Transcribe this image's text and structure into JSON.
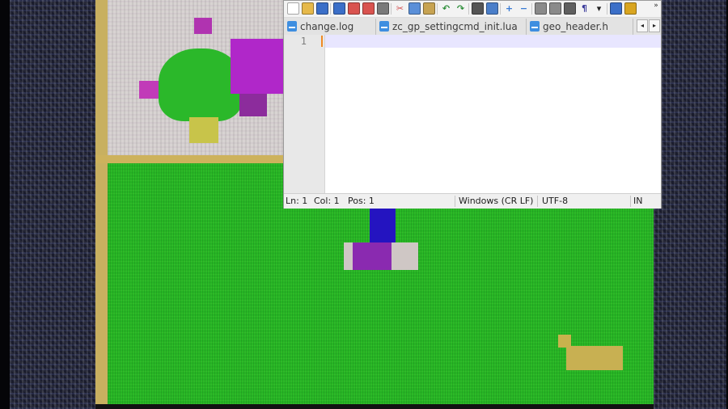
{
  "toolbar": {
    "buttons": [
      {
        "name": "new-file-icon",
        "glyph": "",
        "color": "#ffffff"
      },
      {
        "name": "open-file-icon",
        "glyph": "",
        "color": "#e6b94a"
      },
      {
        "name": "save-icon",
        "glyph": "",
        "color": "#3b6fc8"
      },
      {
        "name": "save-all-icon",
        "glyph": "",
        "color": "#3b6fc8"
      },
      {
        "name": "close-icon",
        "glyph": "",
        "color": "#d9534f"
      },
      {
        "name": "close-all-icon",
        "glyph": "",
        "color": "#d9534f"
      },
      {
        "name": "print-icon",
        "glyph": "",
        "color": "#7a7a7a"
      },
      {
        "name": "cut-icon",
        "glyph": "✂",
        "color": "#d24b4b"
      },
      {
        "name": "copy-icon",
        "glyph": "",
        "color": "#5a8fd8"
      },
      {
        "name": "paste-icon",
        "glyph": "",
        "color": "#c7a352"
      },
      {
        "name": "undo-icon",
        "glyph": "↶",
        "color": "#2f8f3b"
      },
      {
        "name": "redo-icon",
        "glyph": "↷",
        "color": "#2f8f3b"
      },
      {
        "name": "find-icon",
        "glyph": "",
        "color": "#555555"
      },
      {
        "name": "replace-icon",
        "glyph": "",
        "color": "#4a7ec9"
      },
      {
        "name": "zoom-in-icon",
        "glyph": "+",
        "color": "#3a7bd5"
      },
      {
        "name": "zoom-out-icon",
        "glyph": "−",
        "color": "#3a7bd5"
      },
      {
        "name": "sync-vertical-icon",
        "glyph": "",
        "color": "#8a8a8a"
      },
      {
        "name": "sync-horizontal-icon",
        "glyph": "",
        "color": "#8a8a8a"
      },
      {
        "name": "word-wrap-icon",
        "glyph": "",
        "color": "#5f5f5f"
      },
      {
        "name": "show-all-characters-icon",
        "glyph": "¶",
        "color": "#3a3a9a"
      },
      {
        "name": "dropdown-arrow-icon",
        "glyph": "▾",
        "color": "#222222"
      },
      {
        "name": "indent-guide-icon",
        "glyph": "",
        "color": "#3b6fc8"
      },
      {
        "name": "user-language-icon",
        "glyph": "",
        "color": "#d9a520"
      }
    ],
    "overflow_glyph": "»"
  },
  "tabs": [
    {
      "label": "change.log"
    },
    {
      "label": "zc_gp_settingcmd_init.lua"
    },
    {
      "label": "geo_header.h"
    }
  ],
  "tab_scroll": {
    "left": "◂",
    "right": "▸"
  },
  "editor": {
    "line_number": "1",
    "content": ""
  },
  "status": {
    "ln": "Ln: 1",
    "col": "Col: 1",
    "pos": "Pos: 1",
    "eol": "Windows (CR LF)",
    "encoding": "UTF-8",
    "mode": "IN"
  },
  "colors": {
    "accent": "#3e8ee0",
    "caret": "#f08a24",
    "current_line": "#e8e6ff",
    "grass": "#27b525"
  }
}
